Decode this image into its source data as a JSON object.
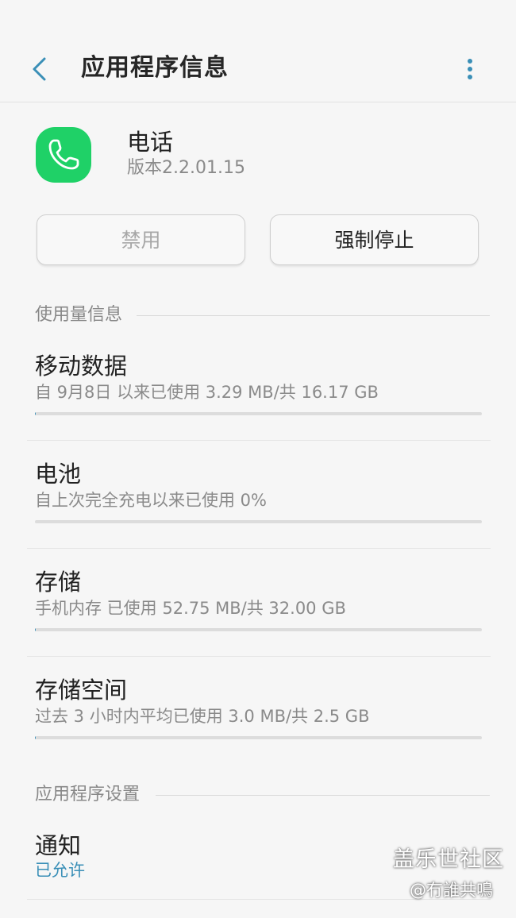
{
  "header": {
    "title": "应用程序信息",
    "back_icon": "chevron-left-icon",
    "more_icon": "more-vertical-icon",
    "accent_color": "#3a8fb7"
  },
  "app": {
    "name": "电话",
    "version": "版本2.2.01.15",
    "icon": "phone-icon",
    "icon_color": "#1fd167"
  },
  "buttons": {
    "disable_label": "禁用",
    "force_stop_label": "强制停止"
  },
  "usage_section": {
    "title": "使用量信息",
    "items": [
      {
        "title": "移动数据",
        "subtitle": "自 9月8日 以来已使用 3.29 MB/共 16.17 GB",
        "progress": 0.0002
      },
      {
        "title": "电池",
        "subtitle": "自上次完全充电以来已使用 0%",
        "progress": 0
      },
      {
        "title": "存储",
        "subtitle": "手机内存 已使用 52.75 MB/共 32.00 GB",
        "progress": 0.0016
      },
      {
        "title": "存储空间",
        "subtitle": "过去 3 小时内平均已使用 3.0 MB/共 2.5 GB",
        "progress": 0.0012
      }
    ]
  },
  "settings_section": {
    "title": "应用程序设置",
    "notification": {
      "title": "通知",
      "status": "已允许"
    }
  },
  "watermark": {
    "main": "盖乐世社区",
    "sub": "@冇誰共鳴"
  }
}
